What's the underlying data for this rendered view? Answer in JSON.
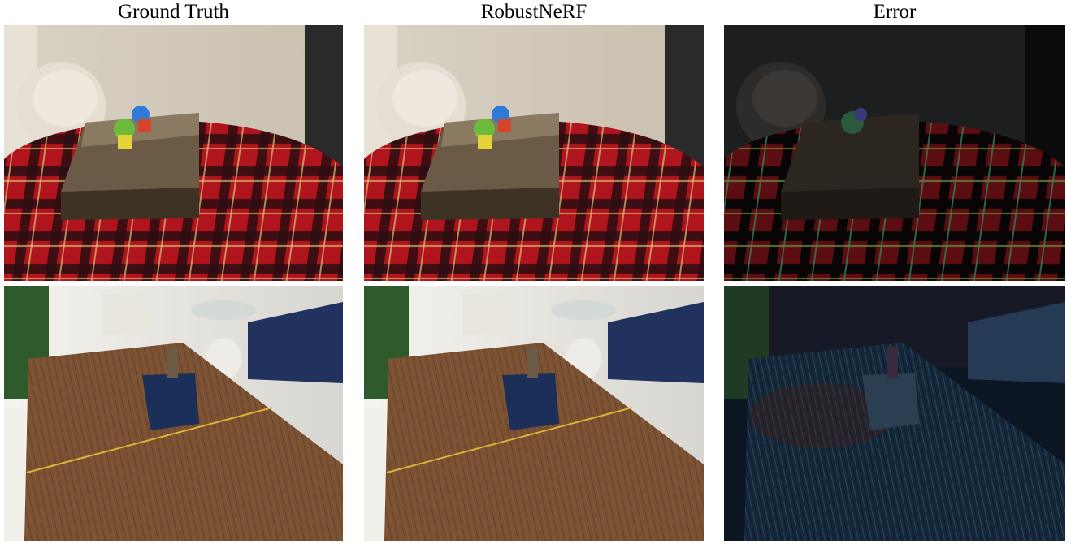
{
  "columns": [
    {
      "title": "Ground Truth"
    },
    {
      "title": "RobustNeRF"
    },
    {
      "title": "Error"
    }
  ],
  "scenes": [
    {
      "description_icon": "boardgame-table-scene"
    },
    {
      "description_icon": "dining-table-scene"
    }
  ],
  "colors": {
    "plaid_red": "#b0141c",
    "plaid_dark": "#1a0a0a",
    "wood": "#7a5132",
    "sofa": "#22325e",
    "error_bg": "#0b1622"
  }
}
